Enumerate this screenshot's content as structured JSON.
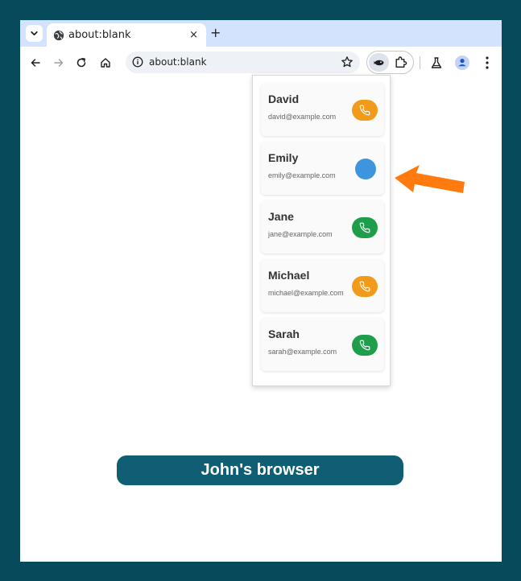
{
  "browser": {
    "tab": {
      "title": "about:blank",
      "close_glyph": "×",
      "favicon": "globe-icon"
    },
    "new_tab_glyph": "+",
    "address_bar": {
      "url": "about:blank"
    }
  },
  "extension_popup": {
    "contacts": [
      {
        "name": "David",
        "email": "david@example.com",
        "call_state": "ringing",
        "call_color": "#f29b1a"
      },
      {
        "name": "Emily",
        "email": "emily@example.com",
        "call_state": "loading",
        "call_color": "#3d95de"
      },
      {
        "name": "Jane",
        "email": "jane@example.com",
        "call_state": "available",
        "call_color": "#1e9e4a"
      },
      {
        "name": "Michael",
        "email": "michael@example.com",
        "call_state": "ringing",
        "call_color": "#f29b1a"
      },
      {
        "name": "Sarah",
        "email": "sarah@example.com",
        "call_state": "available",
        "call_color": "#1e9e4a"
      }
    ]
  },
  "annotation": {
    "arrow_color": "#ff7a0f"
  },
  "caption": {
    "text": "John's browser"
  },
  "colors": {
    "background": "#064a5c",
    "tabstrip": "#d3e3fd",
    "caption_bg": "#0f5e73"
  }
}
